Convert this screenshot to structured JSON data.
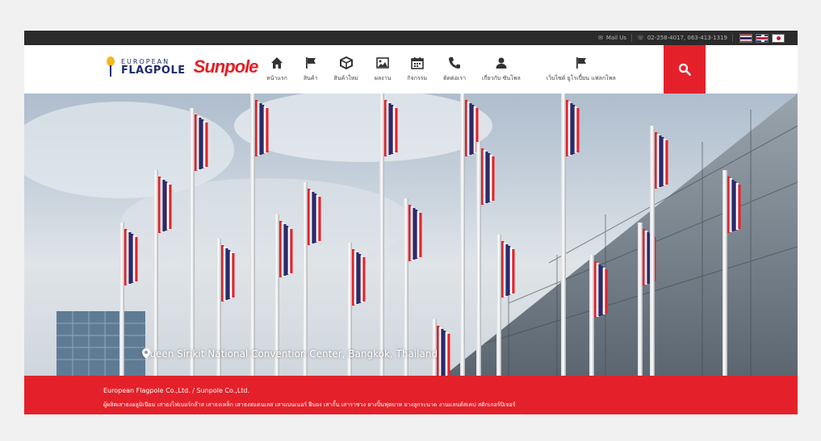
{
  "topbar": {
    "mail_label": "Mail Us",
    "phone": "02-258-4017, 063-413-1319",
    "flags": [
      "th-flag",
      "uk-flag",
      "jp-flag"
    ]
  },
  "logo": {
    "line1": "EUROPEAN",
    "line2": "FLAGPOLE",
    "brand": "Sunpole"
  },
  "menu": [
    {
      "label": "หน้าแรก",
      "icon": "home-icon"
    },
    {
      "label": "สินค้า",
      "icon": "flag-icon"
    },
    {
      "label": "สินค้าใหม่",
      "icon": "box-icon"
    },
    {
      "label": "ผลงาน",
      "icon": "image-icon"
    },
    {
      "label": "กิจกรรม",
      "icon": "calendar-icon"
    },
    {
      "label": "ติดต่อเรา",
      "icon": "phone-icon"
    },
    {
      "label": "เกี่ยวกับ ซันโพล",
      "icon": "user-icon"
    },
    {
      "label": "เว็บไซต์ ยูโรเปี้ยน แฟลกโพล",
      "icon": "flag-icon"
    }
  ],
  "hero": {
    "caption": "Queen Sirikit National Convention Center, Bangkok, Thailand"
  },
  "footer": {
    "company": "European Flagpole Co.,Ltd. / Sunpole Co.,Ltd.",
    "description": "ผู้ผลิตเสาธงอลูมิเนียม เสาธงไฟเบอร์กล๊าส เสาธงเหล็ก เสาธงสแตนเลส เสาแบนเนอร์ ฝีบอง เสากั้น เสาราชวง ยางปิ้นฟุตบาท ยางลูกระนาด งานแลนด์สเคป สติกเกอร์ปิเจอร์"
  },
  "colors": {
    "accent": "#e4212a",
    "topbar": "#2b2b2b"
  }
}
